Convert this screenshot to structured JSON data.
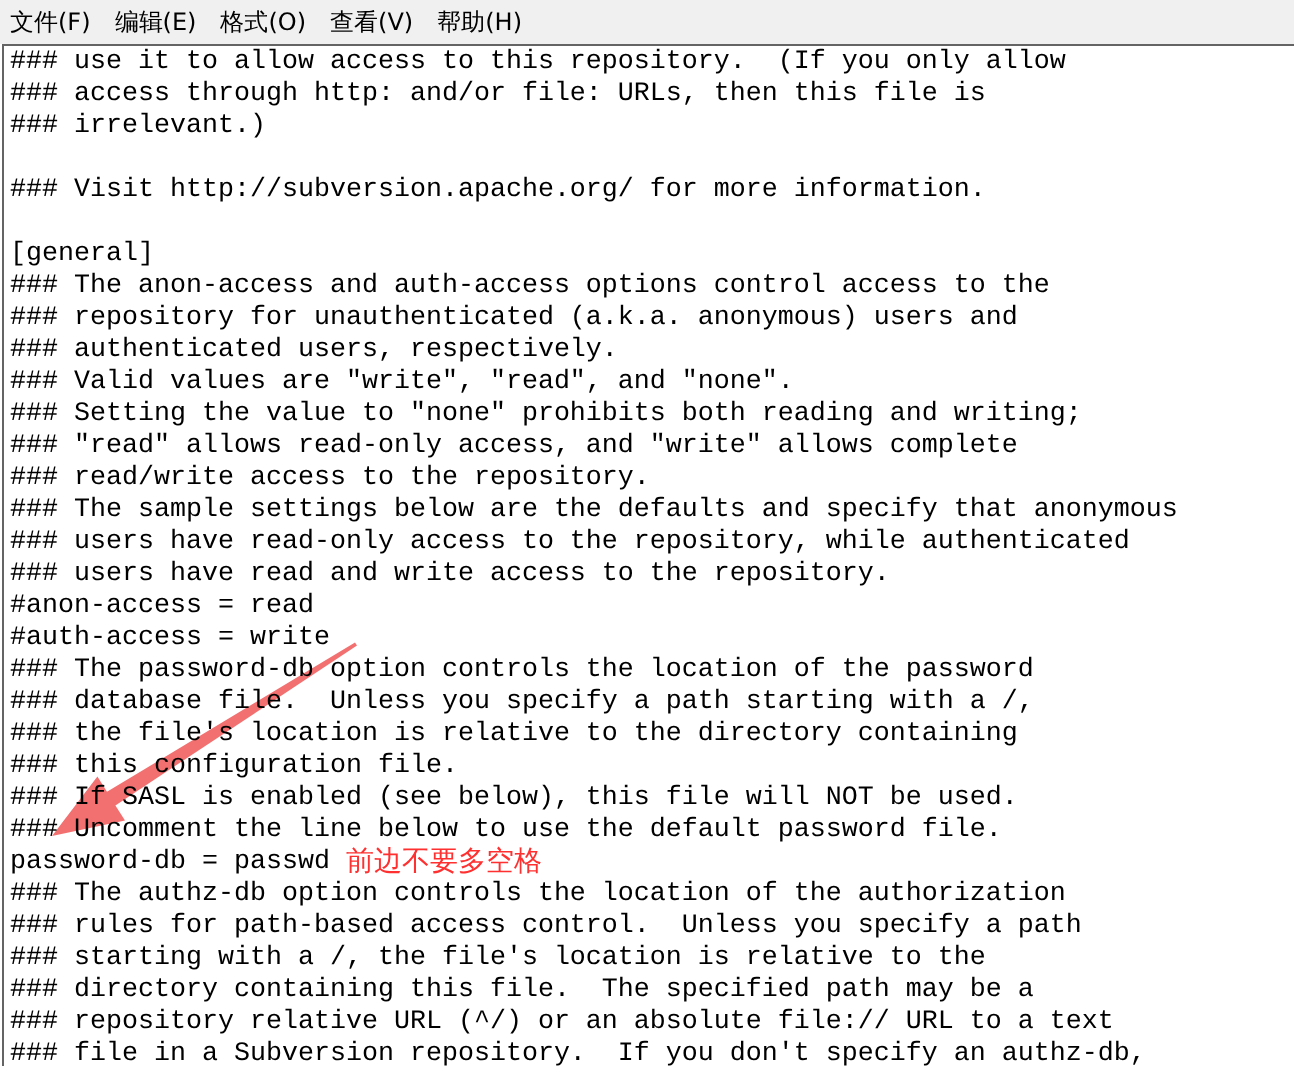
{
  "menu_bar": [
    "文件(F)",
    "编辑(E)",
    "格式(O)",
    "查看(V)",
    "帮助(H)"
  ],
  "lines": [
    {
      "kind": "text",
      "text": "### use it to allow access to this repository.  (If you only allow"
    },
    {
      "kind": "text",
      "text": "### access through http: and/or file: URLs, then this file is"
    },
    {
      "kind": "text",
      "text": "### irrelevant.)"
    },
    {
      "kind": "blank"
    },
    {
      "kind": "text",
      "text": "### Visit http://subversion.apache.org/ for more information."
    },
    {
      "kind": "blank"
    },
    {
      "kind": "text",
      "text": "[general]"
    },
    {
      "kind": "text",
      "text": "### The anon-access and auth-access options control access to the"
    },
    {
      "kind": "text",
      "text": "### repository for unauthenticated (a.k.a. anonymous) users and"
    },
    {
      "kind": "text",
      "text": "### authenticated users, respectively."
    },
    {
      "kind": "text",
      "text": "### Valid values are \"write\", \"read\", and \"none\"."
    },
    {
      "kind": "text",
      "text": "### Setting the value to \"none\" prohibits both reading and writing;"
    },
    {
      "kind": "text",
      "text": "### \"read\" allows read-only access, and \"write\" allows complete"
    },
    {
      "kind": "text",
      "text": "### read/write access to the repository."
    },
    {
      "kind": "text",
      "text": "### The sample settings below are the defaults and specify that anonymous"
    },
    {
      "kind": "text",
      "text": "### users have read-only access to the repository, while authenticated"
    },
    {
      "kind": "text",
      "text": "### users have read and write access to the repository."
    },
    {
      "kind": "text",
      "text": "#anon-access = read"
    },
    {
      "kind": "text",
      "text": "#auth-access = write"
    },
    {
      "kind": "text",
      "text": "### The password-db option controls the location of the password"
    },
    {
      "kind": "text",
      "text": "### database file.  Unless you specify a path starting with a /,"
    },
    {
      "kind": "text",
      "text": "### the file's location is relative to the directory containing"
    },
    {
      "kind": "text",
      "text": "### this configuration file."
    },
    {
      "kind": "text",
      "text": "### If SASL is enabled (see below), this file will NOT be used."
    },
    {
      "kind": "text",
      "text": "### Uncomment the line below to use the default password file."
    },
    {
      "kind": "text",
      "text": "password-db = passwd"
    },
    {
      "kind": "text",
      "text": "### The authz-db option controls the location of the authorization"
    },
    {
      "kind": "text",
      "text": "### rules for path-based access control.  Unless you specify a path"
    },
    {
      "kind": "text",
      "text": "### starting with a /, the file's location is relative to the"
    },
    {
      "kind": "text",
      "text": "### directory containing this file.  The specified path may be a"
    },
    {
      "kind": "text",
      "text": "### repository relative URL (^/) or an absolute file:// URL to a text"
    },
    {
      "kind": "text",
      "text": "### file in a Subversion repository.  If you don't specify an authz-db,"
    }
  ],
  "annotation": {
    "text": "前边不要多空格"
  }
}
